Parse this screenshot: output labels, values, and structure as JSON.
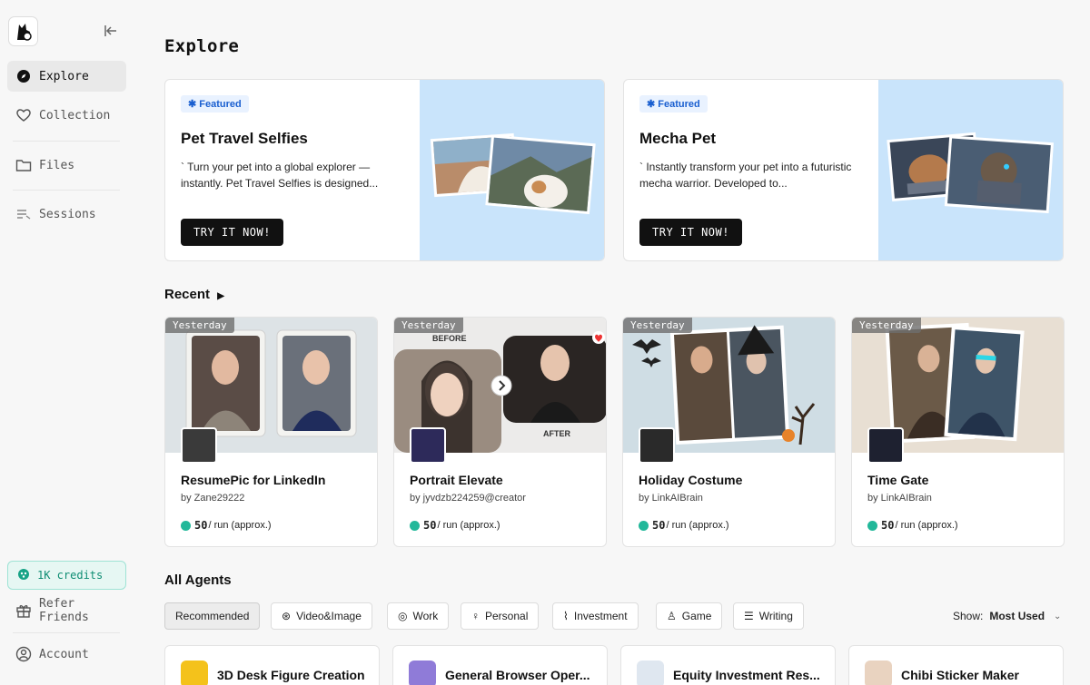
{
  "sidebar": {
    "items": [
      {
        "label": "Explore",
        "icon": "compass-icon"
      },
      {
        "label": "Collection",
        "icon": "heart-icon"
      },
      {
        "label": "Files",
        "icon": "folder-icon"
      },
      {
        "label": "Sessions",
        "icon": "list-icon"
      }
    ],
    "credits": "1K credits",
    "refer": "Refer Friends",
    "account": "Account"
  },
  "main": {
    "title": "Explore",
    "featured": [
      {
        "badge": "Featured",
        "title": "Pet Travel Selfies",
        "desc": "` Turn your pet into a global explorer — instantly. Pet Travel Selfies is designed...",
        "button": "TRY IT NOW!"
      },
      {
        "badge": "Featured",
        "title": "Mecha Pet",
        "desc": "` Instantly transform your pet into a futuristic mecha warrior. Developed to...",
        "button": "TRY IT NOW!"
      }
    ],
    "recent_title": "Recent",
    "recent": [
      {
        "tag": "Yesterday",
        "title": "ResumePic for LinkedIn",
        "by": "by Zane29222",
        "price": "50",
        "unit": "/ run (approx.)"
      },
      {
        "tag": "Yesterday",
        "title": "Portrait Elevate",
        "by": "by jyvdzb224259@creator",
        "price": "50",
        "unit": "/ run (approx.)",
        "before": "BEFORE",
        "after": "AFTER"
      },
      {
        "tag": "Yesterday",
        "title": "Holiday Costume",
        "by": "by LinkAIBrain",
        "price": "50",
        "unit": "/ run (approx.)"
      },
      {
        "tag": "Yesterday",
        "title": "Time Gate",
        "by": "by LinkAIBrain",
        "price": "50",
        "unit": "/ run (approx.)"
      }
    ],
    "all_agents_title": "All Agents",
    "filters": [
      "Recommended",
      "Video&Image",
      "Work",
      "Personal",
      "Investment",
      "Game",
      "Writing"
    ],
    "show_label": "Show:",
    "show_value": "Most Used",
    "agents": [
      {
        "name": "3D Desk Figure Creation"
      },
      {
        "name": "General Browser Oper..."
      },
      {
        "name": "Equity Investment Res..."
      },
      {
        "name": "Chibi Sticker Maker"
      }
    ]
  }
}
